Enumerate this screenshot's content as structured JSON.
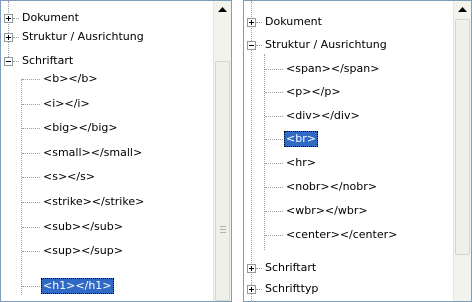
{
  "left_tree": {
    "items": [
      {
        "label": "Dokument"
      },
      {
        "label": "Struktur / Ausrichtung"
      },
      {
        "label": "Schriftart"
      },
      {
        "label": "<b></b>"
      },
      {
        "label": "<i></i>"
      },
      {
        "label": "<big></big>"
      },
      {
        "label": "<small></small>"
      },
      {
        "label": "<s></s>"
      },
      {
        "label": "<strike></strike>"
      },
      {
        "label": "<sub></sub>"
      },
      {
        "label": "<sup></sup>"
      },
      {
        "label": "<h1></h1>"
      }
    ]
  },
  "right_tree": {
    "items": [
      {
        "label": "Dokument"
      },
      {
        "label": "Struktur / Ausrichtung"
      },
      {
        "label": "<span></span>"
      },
      {
        "label": "<p></p>"
      },
      {
        "label": "<div></div>"
      },
      {
        "label": "<br>"
      },
      {
        "label": "<hr>"
      },
      {
        "label": "<nobr></nobr>"
      },
      {
        "label": "<wbr></wbr>"
      },
      {
        "label": "<center></center>"
      },
      {
        "label": "Schriftart"
      },
      {
        "label": "Schrifttyp"
      }
    ]
  },
  "colors": {
    "selection": "#316ac5",
    "border": "#7f9db9"
  }
}
